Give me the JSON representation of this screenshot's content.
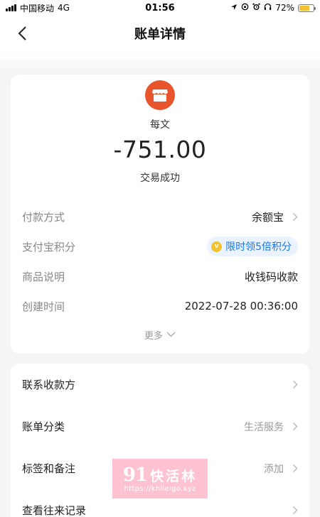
{
  "status_bar": {
    "carrier": "中国移动",
    "network": "4G",
    "time": "01:56",
    "battery_percent": "72%",
    "battery_level": 0.72,
    "icons": [
      "location-icon",
      "screen-lock-icon",
      "alarm-icon",
      "headphones-icon",
      "battery-icon"
    ]
  },
  "nav": {
    "title": "账单详情",
    "back_icon": "chevron-left-icon"
  },
  "summary": {
    "merchant_icon": "storefront-icon",
    "merchant_color": "#e8542b",
    "merchant_name": "每文",
    "amount": "-751.00",
    "status": "交易成功"
  },
  "details": {
    "payment_method_label": "付款方式",
    "payment_method_value": "余额宝",
    "points_label": "支付宝积分",
    "points_badge": "限时领5倍积分",
    "points_icon_letter": "v",
    "product_label": "商品说明",
    "product_value": "收钱码收款",
    "created_label": "创建时间",
    "created_value": "2022-07-28 00:36:00",
    "more_label": "更多"
  },
  "actions": {
    "contact_label": "联系收款方",
    "category_label": "账单分类",
    "category_value": "生活服务",
    "tags_label": "标签和备注",
    "tags_value": "添加",
    "history_label": "查看往来记录"
  },
  "watermark": {
    "number": "91",
    "name": "快活林",
    "url": "https://khllelgo.xyz"
  },
  "colors": {
    "accent_blue": "#1677ff",
    "background": "#f5f5f5",
    "coin_yellow": "#f4c22b"
  }
}
